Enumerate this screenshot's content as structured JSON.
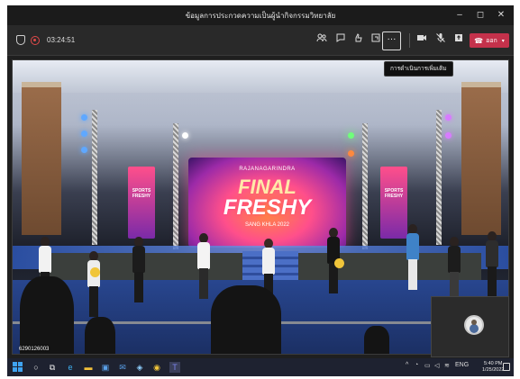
{
  "window": {
    "title": "ข้อมูลการประกวดความเป็นผู้นำกิจกรรมวิทยาลัย",
    "minimize": "–",
    "maximize": "◻",
    "close": "✕"
  },
  "meeting": {
    "timer": "03:24:51",
    "more_label": "···",
    "tooltip": "การดำเนินการเพิ่มเติม",
    "leave_label": "ออก",
    "leave_color": "#c4314b",
    "toolbar_icons": [
      "participants-icon",
      "chat-icon",
      "react-icon",
      "share-tray-icon",
      "more-actions-icon",
      "camera-icon",
      "mic-off-icon",
      "share-icon"
    ]
  },
  "video": {
    "screen_sub": "RAJANAGARINDRA",
    "screen_title_1": "FINAL",
    "screen_title_2": "FRESHY",
    "screen_sub2": "SANG KHLA 2022",
    "banner_text": "SPORTS FRESHY",
    "presenter_label": "6290126003"
  },
  "taskbar": {
    "time": "5:40 PM",
    "date": "1/25/2022",
    "lang": "ENG",
    "apps": [
      "windows-start-icon",
      "search-icon",
      "task-view-icon",
      "edge-icon",
      "file-explorer-icon",
      "store-icon",
      "mail-icon",
      "photos-icon",
      "chrome-icon",
      "teams-icon"
    ]
  }
}
